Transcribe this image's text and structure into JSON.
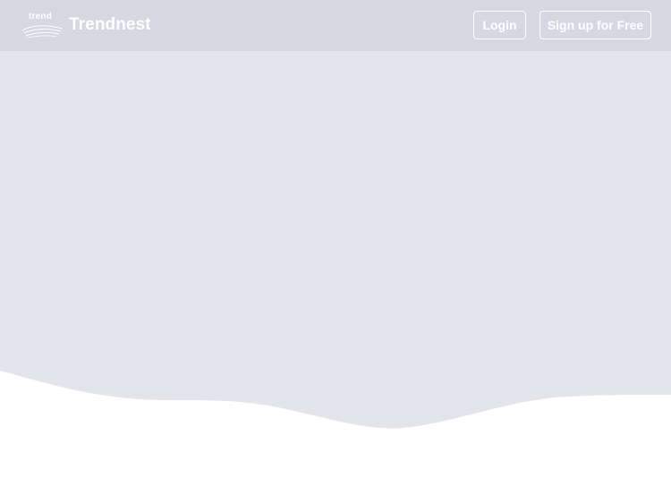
{
  "header": {
    "logo_text": "trend",
    "brand_name": "Trendnest",
    "login_label": "Login",
    "signup_label": "Sign up for Free"
  },
  "colors": {
    "header_background": "#d5d8e0",
    "hero_background": "#e4e5ea",
    "page_background": "#ffffff",
    "header_text": "#ffffff"
  }
}
